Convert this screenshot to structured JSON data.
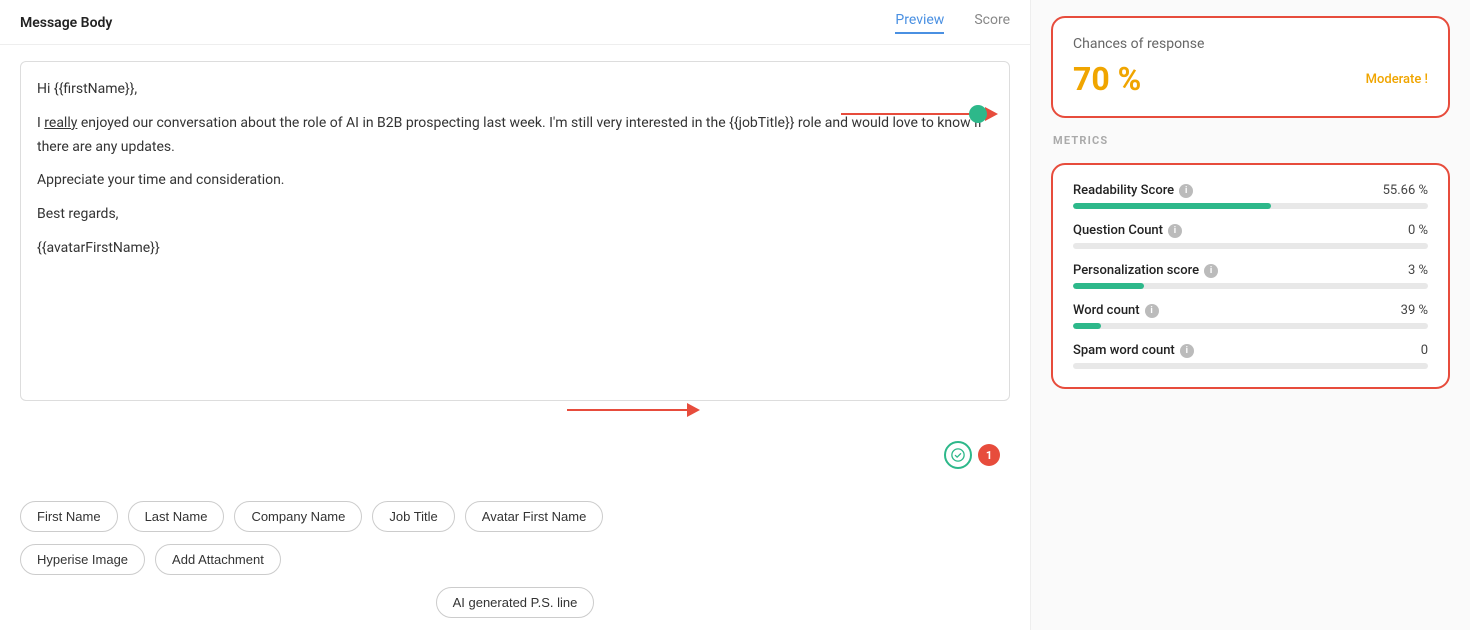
{
  "header": {
    "left_label": "Message Body",
    "tabs": [
      {
        "label": "Preview",
        "active": true
      },
      {
        "label": "Score",
        "active": false
      }
    ]
  },
  "message": {
    "line1": "Hi {{firstName}},",
    "line2_pre": "I ",
    "line2_underlined": "really",
    "line2_post": " enjoyed our conversation about the role of AI in B2B prospecting last week. I'm still very interested in the {{jobTitle}} role and would love to know if there are any updates.",
    "line3": "Appreciate your time and consideration.",
    "line4": "Best regards,",
    "line5": "{{avatarFirstName}}"
  },
  "badge_count": "1",
  "token_buttons": [
    "First Name",
    "Last Name",
    "Company Name",
    "Job Title",
    "Avatar First Name",
    "Hyperise Image",
    "Add Attachment",
    "AI generated P.S. line"
  ],
  "response_card": {
    "title": "Chances of response",
    "percentage": "70 %",
    "label": "Moderate !"
  },
  "metrics_section_label": "METRICS",
  "metrics": [
    {
      "name": "Readability Score",
      "value": "55.66 %",
      "progress": 55.66,
      "color": "#2DB88A"
    },
    {
      "name": "Question Count",
      "value": "0 %",
      "progress": 0,
      "color": "#2DB88A"
    },
    {
      "name": "Personalization score",
      "value": "3 %",
      "progress": 20,
      "color": "#2DB88A"
    },
    {
      "name": "Word count",
      "value": "39 %",
      "progress": 8,
      "color": "#2DB88A"
    },
    {
      "name": "Spam word count",
      "value": "0",
      "progress": 0,
      "color": "#2DB88A"
    }
  ],
  "icons": {
    "info": "i",
    "spell": "✓"
  }
}
